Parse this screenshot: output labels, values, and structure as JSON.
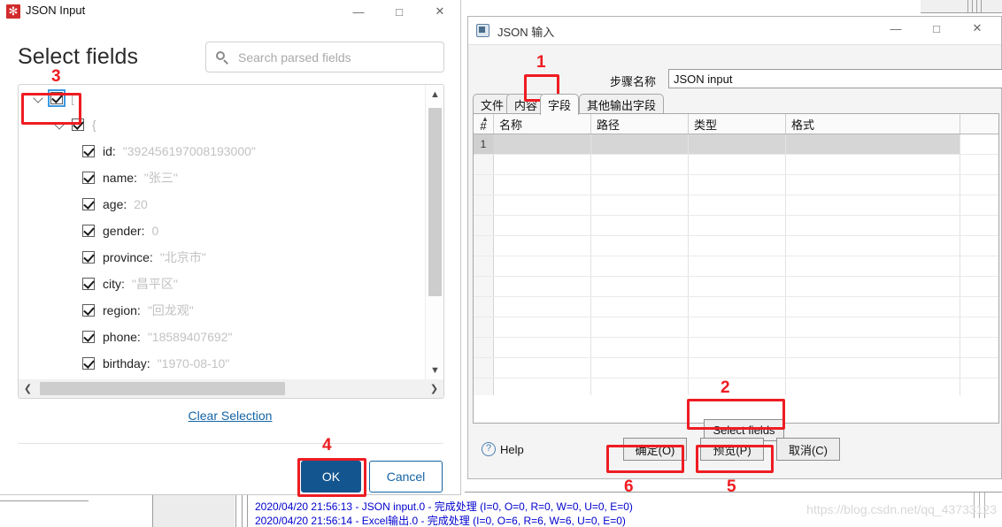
{
  "left_dialog": {
    "title": "JSON Input",
    "app_icon": "json-puzzle-icon",
    "window_controls": {
      "minimize": "—",
      "maximize": "□",
      "close": "✕"
    },
    "heading": "Select fields",
    "search": {
      "placeholder": "Search parsed fields",
      "value": "",
      "icon": "search-icon"
    },
    "tree": {
      "root_bracket": "[",
      "object_brace": "{",
      "nodes": [
        {
          "key": "id",
          "value": "\"392456197008193000\"",
          "checked": true
        },
        {
          "key": "name",
          "value": "\"张三\"",
          "checked": true
        },
        {
          "key": "age",
          "value": "20",
          "checked": true
        },
        {
          "key": "gender",
          "value": "0",
          "checked": true
        },
        {
          "key": "province",
          "value": "\"北京市\"",
          "checked": true
        },
        {
          "key": "city",
          "value": "\"昌平区\"",
          "checked": true
        },
        {
          "key": "region",
          "value": "\"回龙观\"",
          "checked": true
        },
        {
          "key": "phone",
          "value": "\"18589407692\"",
          "checked": true
        },
        {
          "key": "birthday",
          "value": "\"1970-08-10\"",
          "checked": true
        }
      ]
    },
    "clear_selection": "Clear Selection",
    "ok_label": "OK",
    "cancel_label": "Cancel"
  },
  "right_dialog": {
    "title": "JSON 输入",
    "app_icon": "pdi-step-icon",
    "window_controls": {
      "minimize": "—",
      "maximize": "□",
      "close": "✕"
    },
    "step_name_label": "步骤名称",
    "step_name_value": "JSON input",
    "tabs": [
      {
        "label": "文件",
        "selected": false
      },
      {
        "label": "内容",
        "selected": false
      },
      {
        "label": "字段",
        "selected": true
      },
      {
        "label": "其他输出字段",
        "selected": false
      }
    ],
    "grid": {
      "columns": [
        "#",
        "名称",
        "路径",
        "类型",
        "格式"
      ],
      "rows": [
        {
          "num": "1",
          "name": "",
          "path": "",
          "type": "",
          "format": "",
          "selected": true
        },
        {
          "num": "",
          "name": "",
          "path": "",
          "type": "",
          "format": "",
          "selected": false
        },
        {
          "num": "",
          "name": "",
          "path": "",
          "type": "",
          "format": "",
          "selected": false
        },
        {
          "num": "",
          "name": "",
          "path": "",
          "type": "",
          "format": "",
          "selected": false
        },
        {
          "num": "",
          "name": "",
          "path": "",
          "type": "",
          "format": "",
          "selected": false
        },
        {
          "num": "",
          "name": "",
          "path": "",
          "type": "",
          "format": "",
          "selected": false
        },
        {
          "num": "",
          "name": "",
          "path": "",
          "type": "",
          "format": "",
          "selected": false
        },
        {
          "num": "",
          "name": "",
          "path": "",
          "type": "",
          "format": "",
          "selected": false
        },
        {
          "num": "",
          "name": "",
          "path": "",
          "type": "",
          "format": "",
          "selected": false
        },
        {
          "num": "",
          "name": "",
          "path": "",
          "type": "",
          "format": "",
          "selected": false
        },
        {
          "num": "",
          "name": "",
          "path": "",
          "type": "",
          "format": "",
          "selected": false
        },
        {
          "num": "",
          "name": "",
          "path": "",
          "type": "",
          "format": "",
          "selected": false
        },
        {
          "num": "",
          "name": "",
          "path": "",
          "type": "",
          "format": "",
          "selected": false
        }
      ]
    },
    "select_fields_label": "Select fields",
    "help_label": "Help",
    "ok_label": "确定(O)",
    "preview_label": "预览(P)",
    "cancel_label": "取消(C)"
  },
  "annotations": {
    "n1": "1",
    "n2": "2",
    "n3": "3",
    "n4": "4",
    "n5": "5",
    "n6": "6"
  },
  "background": {
    "log_line_1": "2020/04/20 21:56:13 - JSON input.0 - 完成处理 (I=0, O=0, R=0, W=0, U=0, E=0)",
    "log_line_2": "2020/04/20 21:56:14 - Excel输出.0 - 完成处理 (I=0, O=6, R=6, W=6, U=0, E=0)"
  },
  "watermark": "https://blog.csdn.net/qq_43733123",
  "colors": {
    "annotation_red": "#ee1c22",
    "ok_blue": "#13558f",
    "link_blue": "#1464a5",
    "log_blue": "#0000cd"
  }
}
